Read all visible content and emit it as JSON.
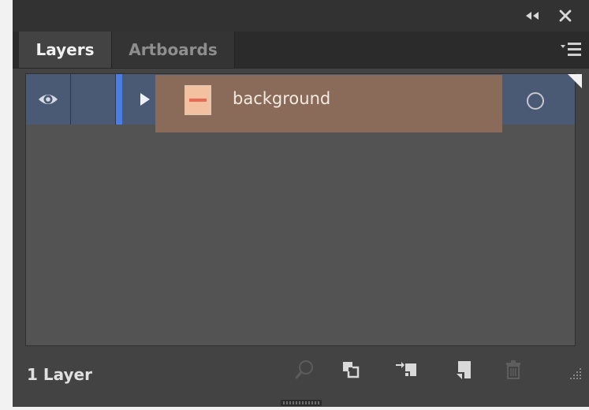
{
  "window": {
    "collapse_label": "◂◂",
    "close_label": "✕"
  },
  "tabs": [
    {
      "label": "Layers",
      "active": true
    },
    {
      "label": "Artboards",
      "active": false
    }
  ],
  "layers": [
    {
      "name": "background",
      "visible": true,
      "selected": true,
      "thumbnail_color": "#f3c19f",
      "thumbnail_mark_color": "#ea6b55",
      "indicator_color": "#4a7de6"
    }
  ],
  "footer": {
    "status": "1 Layer"
  },
  "colors": {
    "panel_bg": "#434343",
    "titlebar_bg": "#323232",
    "tab_active_bg": "#434343",
    "list_bg": "#535353",
    "row_selected_bg": "#4a5a74",
    "highlight_bg": "#8a6b5a"
  },
  "icons": {
    "collapse": "double-chevron-left-icon",
    "close": "close-icon",
    "panel_menu": "panel-menu-icon",
    "visibility": "eye-icon",
    "expand": "expand-arrow-icon",
    "target": "target-circle-icon",
    "locate": "search-icon",
    "clip": "clipping-mask-icon",
    "sublayer": "create-sublayer-icon",
    "new_layer": "new-layer-icon",
    "delete": "trash-icon",
    "resize": "resize-grip-icon"
  }
}
